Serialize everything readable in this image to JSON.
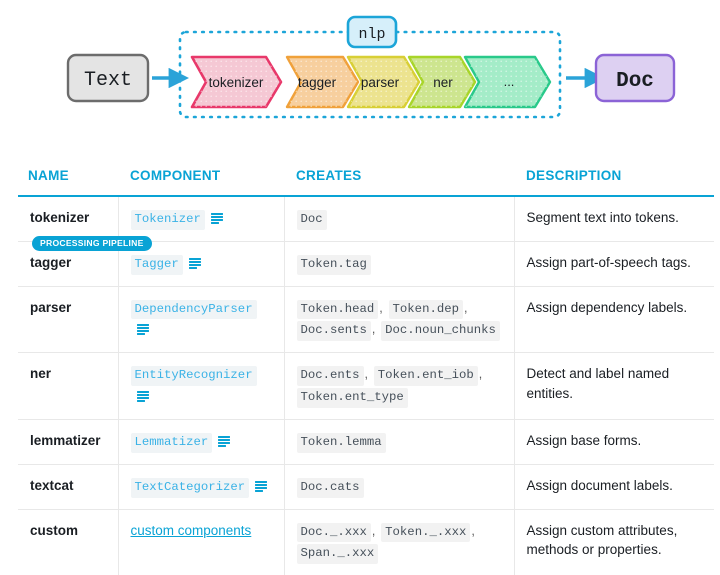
{
  "diagram": {
    "input_label": "Text",
    "output_label": "Doc",
    "container_label": "nlp",
    "stages": [
      {
        "label": "tokenizer",
        "fill": "#f5c8d4",
        "stroke": "#e8386a"
      },
      {
        "label": "tagger",
        "fill": "#f7cf9e",
        "stroke": "#f0a13a"
      },
      {
        "label": "parser",
        "fill": "#ece38f",
        "stroke": "#d8cf35"
      },
      {
        "label": "ner",
        "fill": "#cde58f",
        "stroke": "#a8d529"
      },
      {
        "label": "...",
        "fill": "#a4ecc8",
        "stroke": "#29c98a"
      }
    ],
    "input_fill": "#e4e4e4",
    "input_stroke": "#6c6c6c",
    "output_fill": "#ddd0f2",
    "output_stroke": "#8b63d6",
    "nlp_fill": "#d6effa",
    "nlp_stroke": "#1ca5d8",
    "arrow_color": "#2ba3d8",
    "dotted_color": "#1ca5d8"
  },
  "badge": {
    "label": "PROCESSING PIPELINE",
    "color": "#09a3d5"
  },
  "table": {
    "accent": "#09a3d5",
    "headers": [
      "NAME",
      "COMPONENT",
      "CREATES",
      "DESCRIPTION"
    ],
    "rows": [
      {
        "name": "tokenizer",
        "component": {
          "kind": "api",
          "text": "Tokenizer"
        },
        "creates": [
          "Doc"
        ],
        "description": "Segment text into tokens."
      },
      {
        "name": "tagger",
        "component": {
          "kind": "api",
          "text": "Tagger"
        },
        "creates": [
          "Token.tag"
        ],
        "description": "Assign part-of-speech tags."
      },
      {
        "name": "parser",
        "component": {
          "kind": "api",
          "text": "DependencyParser"
        },
        "creates": [
          "Token.head",
          "Token.dep",
          "Doc.sents",
          "Doc.noun_chunks"
        ],
        "description": "Assign dependency labels."
      },
      {
        "name": "ner",
        "component": {
          "kind": "api",
          "text": "EntityRecognizer"
        },
        "creates": [
          "Doc.ents",
          "Token.ent_iob",
          "Token.ent_type"
        ],
        "description": "Detect and label named entities."
      },
      {
        "name": "lemmatizer",
        "component": {
          "kind": "api",
          "text": "Lemmatizer"
        },
        "creates": [
          "Token.lemma"
        ],
        "description": "Assign base forms."
      },
      {
        "name": "textcat",
        "component": {
          "kind": "api",
          "text": "TextCategorizer"
        },
        "creates": [
          "Doc.cats"
        ],
        "description": "Assign document labels."
      },
      {
        "name": "custom",
        "component": {
          "kind": "link",
          "text": "custom components"
        },
        "creates": [
          "Doc._.xxx",
          "Token._.xxx",
          "Span._.xxx"
        ],
        "description": "Assign custom attributes, methods or properties."
      }
    ]
  }
}
